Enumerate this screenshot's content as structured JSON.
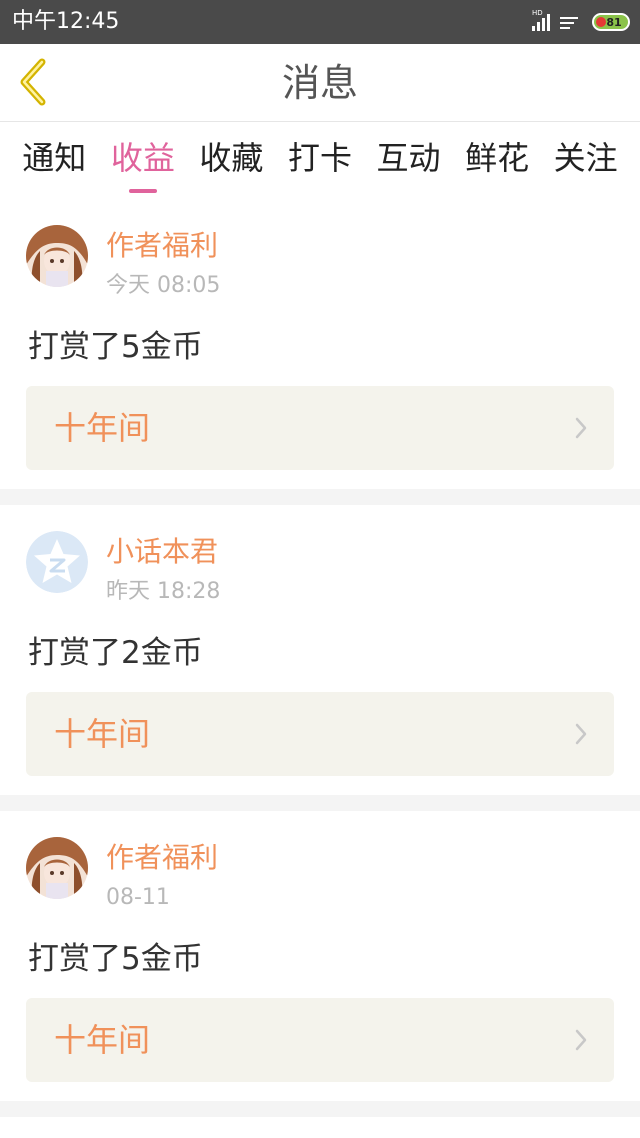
{
  "status_bar": {
    "time": "中午12:45",
    "network": "HD",
    "battery_level": "81",
    "icons": [
      "signal-icon",
      "wifi-icon",
      "battery-icon"
    ]
  },
  "header": {
    "title": "消息",
    "back_icon": "chevron-left-icon"
  },
  "tabs": [
    {
      "label": "通知",
      "active": false
    },
    {
      "label": "收益",
      "active": true
    },
    {
      "label": "收藏",
      "active": false
    },
    {
      "label": "打卡",
      "active": false
    },
    {
      "label": "互动",
      "active": false
    },
    {
      "label": "鲜花",
      "active": false
    },
    {
      "label": "关注",
      "active": false
    }
  ],
  "messages": [
    {
      "user": "作者福利",
      "time": "今天 08:05",
      "text": "打赏了5金币",
      "book": "十年间",
      "avatar": "anime-girl-avatar"
    },
    {
      "user": "小话本君",
      "time": "昨天 18:28",
      "text": "打赏了2金币",
      "book": "十年间",
      "avatar": "star-z-avatar"
    },
    {
      "user": "作者福利",
      "time": "08-11",
      "text": "打赏了5金币",
      "book": "十年间",
      "avatar": "anime-girl-avatar"
    }
  ],
  "colors": {
    "accent_pink": "#e0639c",
    "name_orange": "#f0915a",
    "back_yellow": "#d4b400",
    "status_bar": "#4a4a4a"
  }
}
